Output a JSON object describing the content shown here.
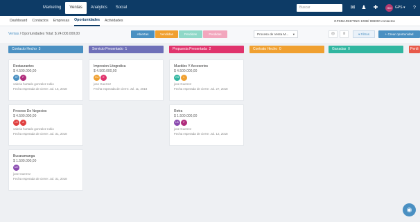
{
  "topnav": [
    "Marketing",
    "Ventas",
    "Analytics",
    "Social"
  ],
  "search_placeholder": "Buscar",
  "user": {
    "initials": "GM",
    "label": "GPS ▾"
  },
  "subnav": [
    "Dashboard",
    "Contactos",
    "Empresas",
    "Oportunidades",
    "Actividades"
  ],
  "account_info": "GPSMARKETING     100B/ 999000 contactos",
  "breadcrumb": {
    "link": "Ventas",
    "sep": "/",
    "page": "Oportunidades",
    "total": "Total: $ 24.000.000,00"
  },
  "status_pills": [
    "Abiertas",
    "Vendidas",
    "Perdidas",
    "Perdidas"
  ],
  "pipeline_select": "Proceso de Venta M...",
  "filter_label": "Filtros",
  "create_label": "+ Crear oportunidad",
  "columns": [
    {
      "name": "Contacto Hecho",
      "count": "3",
      "color": "#4a90c2"
    },
    {
      "name": "Servicio Presentado",
      "count": "1",
      "color": "#6e6fb8"
    },
    {
      "name": "Propuesta Presentada",
      "count": "2",
      "color": "#e0336c"
    },
    {
      "name": "Contrato Hecho",
      "count": "0",
      "color": "#f0a030"
    },
    {
      "name": "Ganadas",
      "count": "0",
      "color": "#30b6a0"
    },
    {
      "name": "Perdi",
      "count": "",
      "color": "#e85a4a"
    }
  ],
  "cards": {
    "c1a": {
      "title": "Restaurantes",
      "amount": "$ 4.500.000,00",
      "avatars": [
        {
          "i": "JP",
          "c": "#4a90c2"
        },
        {
          "i": "P",
          "c": "#b02d7c"
        }
      ],
      "owner": "valeria hurtado gonzalez rubio",
      "date": "Fecha esperada de cierre: Jul. 15, 2018"
    },
    "c1b": {
      "title": "Proceso De Negocios",
      "amount": "$ 4.500.000,00",
      "avatars": [
        {
          "i": "LS",
          "c": "#e04040"
        },
        {
          "i": "A",
          "c": "#e04040"
        }
      ],
      "owner": "valeria hurtado gonzalez rubio",
      "date": "Fecha esperada de cierre: Jul. 31, 2018"
    },
    "c1c": {
      "title": "Bucaramanga",
      "amount": "$ 1.500.000,00",
      "avatars": [
        {
          "i": "MC",
          "c": "#8a4bb0"
        }
      ],
      "owner": "jose Guerrez",
      "date": "Fecha esperada de cierre: Jul. 31, 2018"
    },
    "c2a": {
      "title": "Impresion Litografica",
      "amount": "$ 4.500.000,00",
      "avatars": [
        {
          "i": "CU",
          "c": "#f0a030"
        },
        {
          "i": "E",
          "c": "#e0336c"
        }
      ],
      "owner": "jose Guerrez",
      "date": "Fecha esperada de cierre: Jul. 11, 2018"
    },
    "c3a": {
      "title": "Muebles Y Accesorios",
      "amount": "$ 4.500.000,00",
      "avatars": [
        {
          "i": "CR",
          "c": "#30b6a0"
        },
        {
          "i": "L",
          "c": "#f0a030"
        }
      ],
      "owner": "jose Guerrez",
      "date": "Fecha esperada de cierre: Jul. 27, 2018"
    },
    "c3b": {
      "title": "Retra",
      "amount": "$ 1.500.000,00",
      "avatars": [
        {
          "i": "LB",
          "c": "#8a4bb0"
        },
        {
          "i": "F",
          "c": "#b02d7c"
        }
      ],
      "owner": "jose Guerrez",
      "date": "Fecha esperada de cierre: Jul. 12, 2018"
    }
  },
  "colors": {
    "topbar": "#0d3b66",
    "accent": "#4a90c2"
  }
}
